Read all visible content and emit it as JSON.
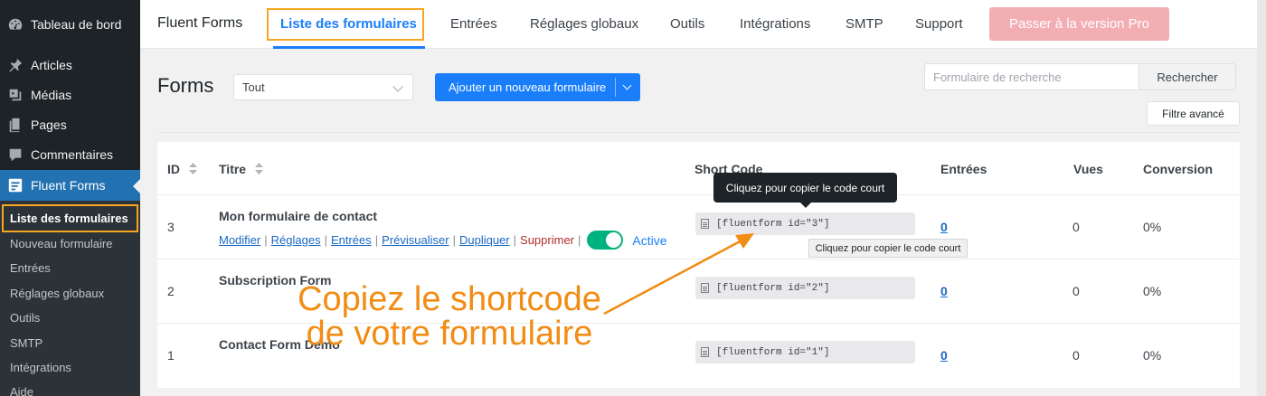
{
  "sidebar": {
    "items": [
      {
        "label": "Tableau de bord",
        "icon": "dashboard-icon"
      },
      {
        "label": "Articles",
        "icon": "pin-icon"
      },
      {
        "label": "Médias",
        "icon": "media-icon"
      },
      {
        "label": "Pages",
        "icon": "page-icon"
      },
      {
        "label": "Commentaires",
        "icon": "comment-icon"
      },
      {
        "label": "Fluent Forms",
        "icon": "fluent-forms-icon"
      }
    ],
    "subitems": [
      {
        "label": "Liste des formulaires"
      },
      {
        "label": "Nouveau formulaire"
      },
      {
        "label": "Entrées"
      },
      {
        "label": "Réglages globaux"
      },
      {
        "label": "Outils"
      },
      {
        "label": "SMTP"
      },
      {
        "label": "Intégrations"
      },
      {
        "label": "Aide"
      }
    ]
  },
  "topnav": {
    "brand": "Fluent Forms",
    "tabs": [
      {
        "label": "Liste des formulaires"
      },
      {
        "label": "Entrées"
      },
      {
        "label": "Réglages globaux"
      },
      {
        "label": "Outils"
      },
      {
        "label": "Intégrations"
      },
      {
        "label": "SMTP"
      },
      {
        "label": "Support"
      }
    ],
    "pro_button": "Passer à la version Pro"
  },
  "toolbar": {
    "title": "Forms",
    "filter_value": "Tout",
    "add_button": "Ajouter un nouveau formulaire",
    "search_placeholder": "Formulaire de recherche",
    "search_button": "Rechercher",
    "advanced_filter": "Filtre avancé"
  },
  "table": {
    "headers": {
      "id": "ID",
      "title": "Titre",
      "shortcode": "Short Code",
      "entries": "Entrées",
      "views": "Vues",
      "conversion": "Conversion"
    },
    "rows": [
      {
        "id": "3",
        "title": "Mon formulaire de contact",
        "shortcode": "[fluentform id=\"3\"]",
        "entries": "0",
        "views": "0",
        "conversion": "0%"
      },
      {
        "id": "2",
        "title": "Subscription Form",
        "shortcode": "[fluentform id=\"2\"]",
        "entries": "0",
        "views": "0",
        "conversion": "0%"
      },
      {
        "id": "1",
        "title": "Contact Form Demo",
        "shortcode": "[fluentform id=\"1\"]",
        "entries": "0",
        "views": "0",
        "conversion": "0%"
      }
    ],
    "row_actions": {
      "edit": "Modifier",
      "settings": "Réglages",
      "entries": "Entrées",
      "preview": "Prévisualiser",
      "duplicate": "Dupliquer",
      "delete": "Supprimer",
      "status": "Active"
    }
  },
  "tooltips": {
    "dark": "Cliquez pour copier le code court",
    "light": "Cliquez pour copier le code court"
  },
  "annotation": {
    "line1": "Copiez le shortcode",
    "line2": "de votre formulaire",
    "color": "#f28c14"
  },
  "colors": {
    "accent": "#1a7efb",
    "sidebar_bg": "#1d2327",
    "highlight": "#f5a623",
    "toggle_on": "#00b27f",
    "danger": "#b32d2e"
  }
}
